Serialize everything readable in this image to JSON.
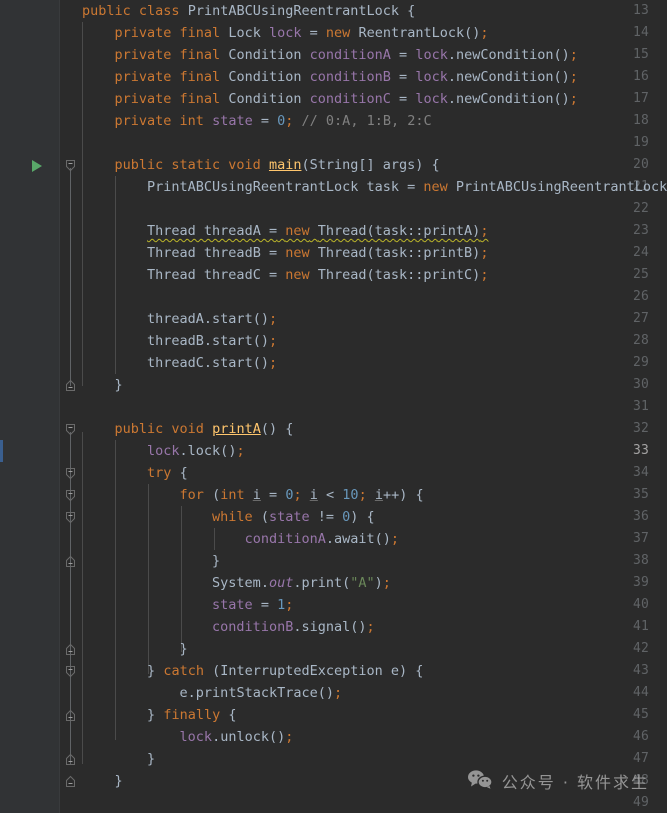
{
  "editor": {
    "language": "java",
    "theme": "darcula",
    "first_visible_line": 13,
    "last_visible_line": 49,
    "caret_line": 33,
    "colors": {
      "background": "#2b2b2b",
      "gutter_background": "#313335",
      "line_number": "#606366",
      "line_number_current": "#a4a3a3",
      "default_text": "#a9b7c6",
      "keyword": "#cc7832",
      "field": "#9876aa",
      "method_declaration": "#ffc66d",
      "number": "#6897bb",
      "string": "#6a8759",
      "comment": "#808080",
      "warning_squiggle": "#bbb529",
      "run_arrow": "#59a869",
      "indent_guide": "#4b4b4b",
      "caret_row_marker": "#3a5f8f"
    }
  },
  "gutter": {
    "line_numbers": [
      13,
      14,
      15,
      16,
      17,
      18,
      19,
      20,
      21,
      22,
      23,
      24,
      25,
      26,
      27,
      28,
      29,
      30,
      31,
      32,
      33,
      34,
      35,
      36,
      37,
      38,
      39,
      40,
      41,
      42,
      43,
      44,
      45,
      46,
      47,
      48,
      49
    ],
    "run_marker_line": 20,
    "run_marker_icon": "run-arrow-icon",
    "fold_marker_icon": "fold-collapse-icon",
    "fold_markers": [
      20,
      30,
      32,
      34,
      35,
      36,
      38,
      42,
      43,
      45,
      47,
      48
    ]
  },
  "code": {
    "lines": [
      {
        "n": 13,
        "text": "public class PrintABCUsingReentrantLock {"
      },
      {
        "n": 14,
        "text": "    private final Lock lock = new ReentrantLock();"
      },
      {
        "n": 15,
        "text": "    private final Condition conditionA = lock.newCondition();"
      },
      {
        "n": 16,
        "text": "    private final Condition conditionB = lock.newCondition();"
      },
      {
        "n": 17,
        "text": "    private final Condition conditionC = lock.newCondition();"
      },
      {
        "n": 18,
        "text": "    private int state = 0; // 0:A, 1:B, 2:C"
      },
      {
        "n": 19,
        "text": ""
      },
      {
        "n": 20,
        "text": "    public static void main(String[] args) {"
      },
      {
        "n": 21,
        "text": "        PrintABCUsingReentrantLock task = new PrintABCUsingReentrantLock();"
      },
      {
        "n": 22,
        "text": ""
      },
      {
        "n": 23,
        "text": "        Thread threadA = new Thread(task::printA);"
      },
      {
        "n": 24,
        "text": "        Thread threadB = new Thread(task::printB);"
      },
      {
        "n": 25,
        "text": "        Thread threadC = new Thread(task::printC);"
      },
      {
        "n": 26,
        "text": ""
      },
      {
        "n": 27,
        "text": "        threadA.start();"
      },
      {
        "n": 28,
        "text": "        threadB.start();"
      },
      {
        "n": 29,
        "text": "        threadC.start();"
      },
      {
        "n": 30,
        "text": "    }"
      },
      {
        "n": 31,
        "text": ""
      },
      {
        "n": 32,
        "text": "    public void printA() {"
      },
      {
        "n": 33,
        "text": "        lock.lock();"
      },
      {
        "n": 34,
        "text": "        try {"
      },
      {
        "n": 35,
        "text": "            for (int i = 0; i < 10; i++) {"
      },
      {
        "n": 36,
        "text": "                while (state != 0) {"
      },
      {
        "n": 37,
        "text": "                    conditionA.await();"
      },
      {
        "n": 38,
        "text": "                }"
      },
      {
        "n": 39,
        "text": "                System.out.print(\"A\");"
      },
      {
        "n": 40,
        "text": "                state = 1;"
      },
      {
        "n": 41,
        "text": "                conditionB.signal();"
      },
      {
        "n": 42,
        "text": "            }"
      },
      {
        "n": 43,
        "text": "        } catch (InterruptedException e) {"
      },
      {
        "n": 44,
        "text": "            e.printStackTrace();"
      },
      {
        "n": 45,
        "text": "        } finally {"
      },
      {
        "n": 46,
        "text": "            lock.unlock();"
      },
      {
        "n": 47,
        "text": "        }"
      },
      {
        "n": 48,
        "text": "    }"
      },
      {
        "n": 49,
        "text": ""
      }
    ],
    "warnings": [
      {
        "line": 23,
        "text": "Thread threadA = new Thread(task::printA);",
        "severity": "warning"
      }
    ]
  },
  "watermark": {
    "icon": "wechat-icon",
    "text": "公众号 · 软件求生"
  }
}
